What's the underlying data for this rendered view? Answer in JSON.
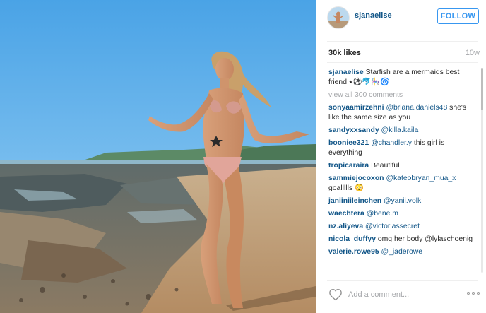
{
  "post": {
    "username": "sjanaelise",
    "follow_label": "FOLLOW",
    "likes": "30k likes",
    "age": "10w",
    "caption_user": "sjanaelise",
    "caption_text": "Starfish are a mermaids best friend ⭑⚽🐬🎠🌀",
    "view_all": "view all 300 comments",
    "add_comment_placeholder": "Add a comment..."
  },
  "comments": [
    {
      "user": "sonyaamirzehni",
      "mention": "@briana.daniels48",
      "text": " she's like the same size as you"
    },
    {
      "user": "sandyxxsandy",
      "mention": "@killa.kaila",
      "text": ""
    },
    {
      "user": "booniee321",
      "mention": "@chandler.y",
      "text": " this girl is everything"
    },
    {
      "user": "tropicaraira",
      "mention": "",
      "text": "Beautiful"
    },
    {
      "user": "sammiejocoxon",
      "mention": "@kateobryan_mua_x",
      "text": " goallllls 😳"
    },
    {
      "user": "janiiniileinchen",
      "mention": "@yanii.volk",
      "text": ""
    },
    {
      "user": "waechtera",
      "mention": "@bene.m",
      "text": ""
    },
    {
      "user": "nz.aliyeva",
      "mention": "@victoriassecret",
      "text": ""
    },
    {
      "user": "nicola_duffyy",
      "mention": "",
      "text": "omg her body @lylaschoenig"
    },
    {
      "user": "valerie.rowe95",
      "mention": "@_jaderowe",
      "text": ""
    }
  ],
  "icons": {
    "heart": "heart-icon",
    "more": "more-options-icon",
    "avatar": "avatar"
  },
  "colors": {
    "link": "#125688",
    "follow": "#3897f0",
    "muted": "#a5a7aa"
  }
}
